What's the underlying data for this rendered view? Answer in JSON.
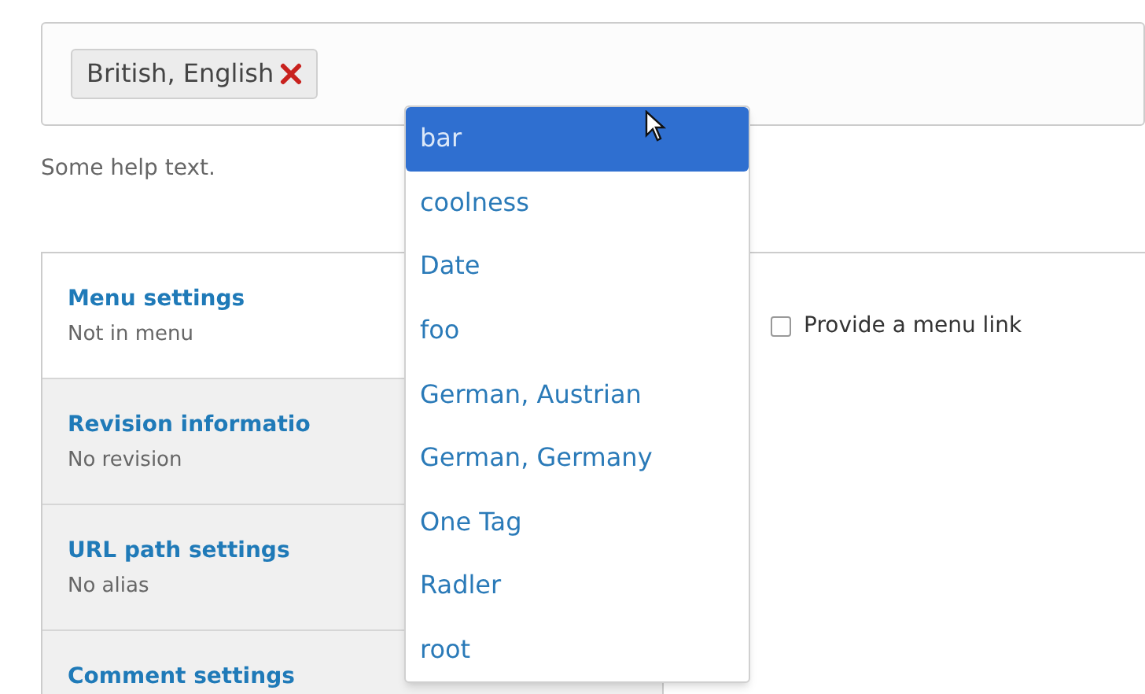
{
  "tags_field": {
    "tags": [
      {
        "label": "British, English"
      }
    ],
    "help_text": "Some help text."
  },
  "autocomplete": {
    "items": [
      {
        "label": "bar",
        "selected": true
      },
      {
        "label": "coolness",
        "selected": false
      },
      {
        "label": "Date",
        "selected": false
      },
      {
        "label": "foo",
        "selected": false
      },
      {
        "label": "German, Austrian",
        "selected": false
      },
      {
        "label": "German, Germany",
        "selected": false
      },
      {
        "label": "One Tag",
        "selected": false
      },
      {
        "label": "Radler",
        "selected": false
      },
      {
        "label": "root",
        "selected": false
      }
    ]
  },
  "vertical_tabs": [
    {
      "title": "Menu settings",
      "summary": "Not in menu",
      "selected": true
    },
    {
      "title": "Revision informatio",
      "summary": "No revision",
      "selected": false
    },
    {
      "title": "URL path settings",
      "summary": "No alias",
      "selected": false
    },
    {
      "title": "Comment settings",
      "selected": false
    }
  ],
  "menu_pane": {
    "checkbox": {
      "label": "Provide a menu link",
      "checked": false
    }
  }
}
